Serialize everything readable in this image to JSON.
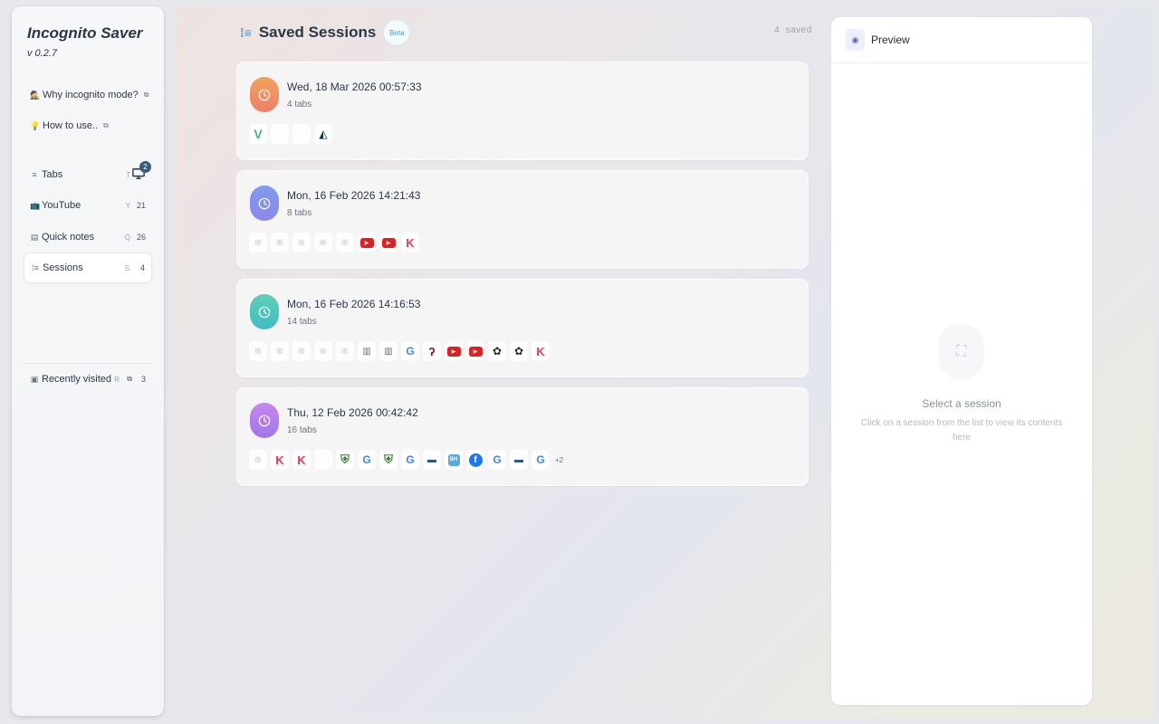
{
  "sidebar": {
    "title": "Incognito Saver",
    "version": "v 0.2.7",
    "links": [
      {
        "label": "Why incognito mode?",
        "icon": "spy-icon"
      },
      {
        "label": "How to use..",
        "icon": "bulb-icon"
      }
    ],
    "nav": [
      {
        "label": "Tabs",
        "shortcut": "T",
        "count": "",
        "badge": "2",
        "icon": "list-icon"
      },
      {
        "label": "YouTube",
        "shortcut": "Y",
        "count": "21",
        "icon": "tv-icon"
      },
      {
        "label": "Quick notes",
        "shortcut": "Q",
        "count": "26",
        "icon": "note-icon"
      },
      {
        "label": "Sessions",
        "shortcut": "S",
        "count": "4",
        "icon": "sessions-icon",
        "active": true
      }
    ],
    "recent": {
      "label": "Recently visited",
      "shortcut": "R",
      "count": "3",
      "icon": "history-icon"
    }
  },
  "header": {
    "title": "Saved Sessions",
    "beta": "Beta",
    "saved_count": "4",
    "saved_label": "saved"
  },
  "sessions": [
    {
      "date": "Wed, 18 Mar 2026 00:57:33",
      "tabs": "4 tabs",
      "color_from": "#f2a25a",
      "color_to": "#ef7f6a",
      "favicons": [
        "vue",
        "blank",
        "blank",
        "prism"
      ]
    },
    {
      "date": "Mon, 16 Feb 2026 14:21:43",
      "tabs": "8 tabs",
      "color_from": "#7f9bef",
      "color_to": "#8a88ec",
      "favicons": [
        "globe",
        "globe",
        "globe",
        "globe",
        "globe",
        "youtube",
        "youtube",
        "k"
      ]
    },
    {
      "date": "Mon, 16 Feb 2026 14:16:53",
      "tabs": "14 tabs",
      "color_from": "#5ed0b6",
      "color_to": "#3fbcc6",
      "favicons": [
        "globe",
        "globe",
        "globe",
        "globe",
        "globe",
        "book",
        "book",
        "google",
        "hook",
        "youtube",
        "youtube",
        "chatgpt",
        "chatgpt",
        "k"
      ]
    },
    {
      "date": "Thu, 12 Feb 2026 00:42:42",
      "tabs": "16 tabs",
      "color_from": "#c887ef",
      "color_to": "#9f75ea",
      "favicons": [
        "globe",
        "k",
        "k",
        "blank",
        "shield",
        "google",
        "shield",
        "google",
        "win",
        "bh",
        "facebook",
        "google",
        "win",
        "google"
      ],
      "more": "+2"
    }
  ],
  "preview": {
    "title": "Preview",
    "empty_title": "Select a session",
    "empty_desc": "Click on a session from the list to view its contents here"
  }
}
